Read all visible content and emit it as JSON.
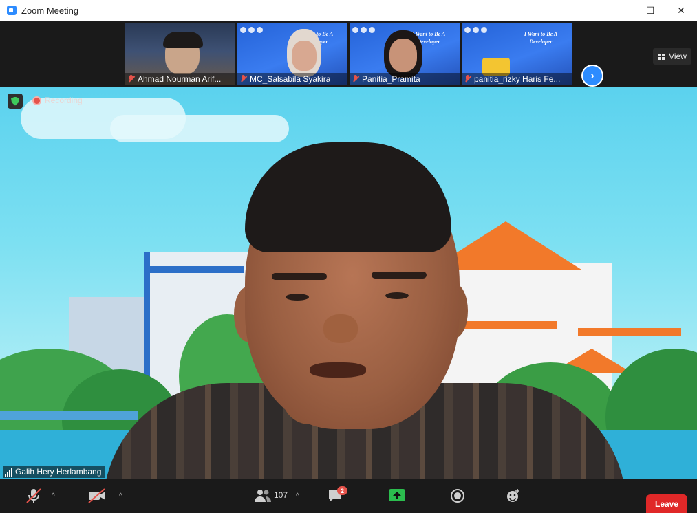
{
  "window": {
    "title": "Zoom Meeting",
    "controls": {
      "minimize": "—",
      "maximize": "☐",
      "close": "✕"
    }
  },
  "top_bar": {
    "view_label": "View",
    "next_page_glyph": "›",
    "participants": [
      {
        "name": "Ahmad Nourman Arif...",
        "muted": true,
        "slide": ""
      },
      {
        "name": "MC_Salsabila Syakira",
        "muted": true,
        "slide": "I Want to Be A Developer"
      },
      {
        "name": "Panitia_Pramita",
        "muted": true,
        "slide": "I Want to Be A Developer"
      },
      {
        "name": "panitia_rizky Haris Fe...",
        "muted": true,
        "slide": "I Want to Be A Developer"
      }
    ]
  },
  "main_video": {
    "recording_label": "Recording",
    "speaker_name": "Galih Hery Herlambang"
  },
  "toolbar": {
    "caret": "^",
    "participants_count": "107",
    "chat_badge": "2",
    "leave_label": "Leave"
  },
  "colors": {
    "accent": "#2d8cff",
    "leave": "#e02828",
    "security": "#3ecb5c",
    "recording": "#e5534b"
  },
  "icons": [
    "zoom-app-icon",
    "grid-view-icon",
    "next-page-icon",
    "security-shield-icon",
    "recording-dot-icon",
    "signal-bars-icon",
    "mic-muted-icon",
    "video-off-icon",
    "participants-icon",
    "chat-icon",
    "share-screen-icon",
    "record-icon",
    "reactions-icon",
    "mic-off-icon"
  ]
}
